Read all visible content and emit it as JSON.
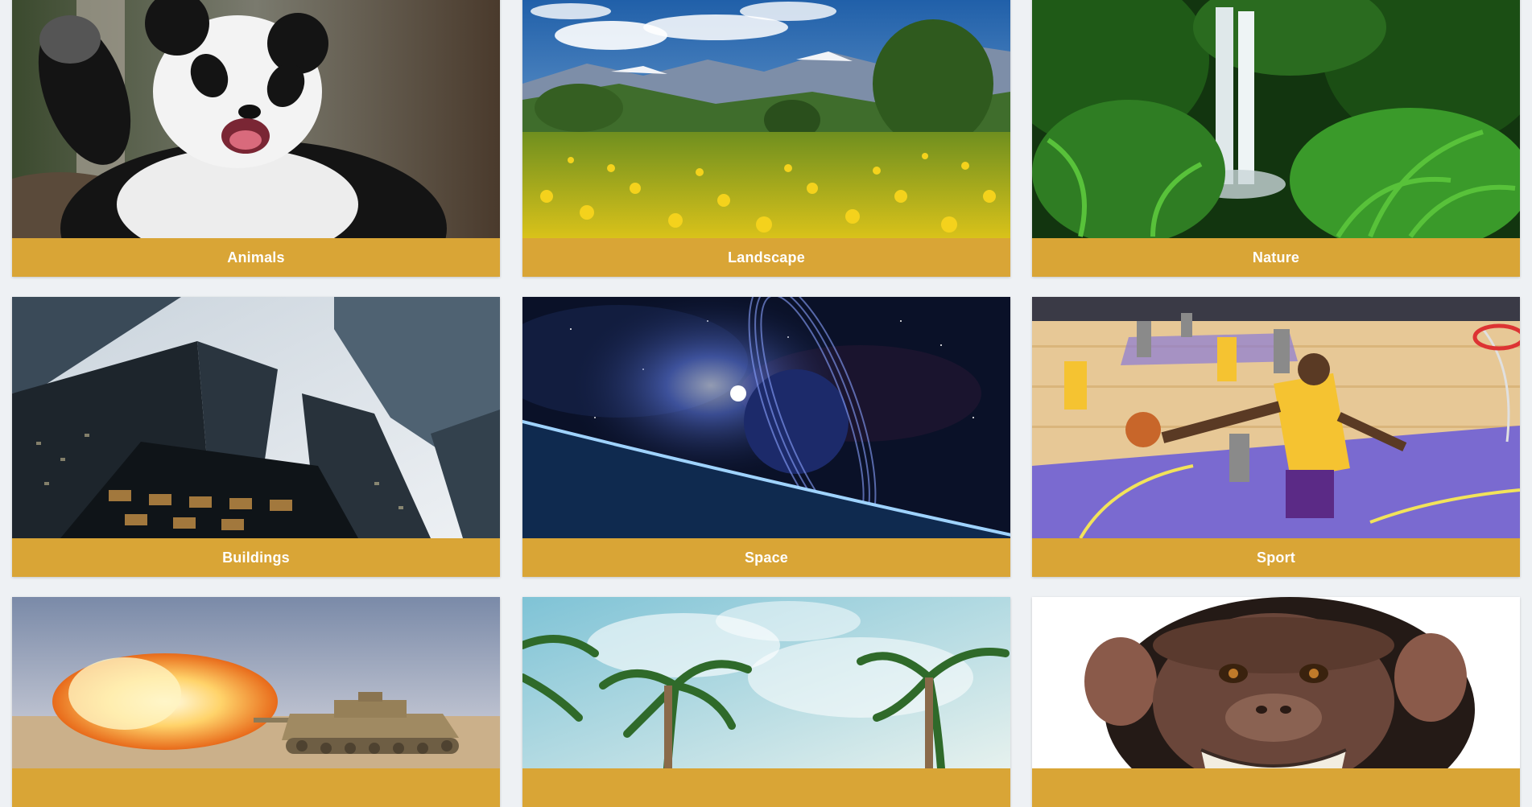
{
  "gallery": {
    "categories": [
      {
        "label": "Animals",
        "image": "giant panda waving"
      },
      {
        "label": "Landscape",
        "image": "mountain meadow with yellow dandelions"
      },
      {
        "label": "Nature",
        "image": "jungle waterfall with ferns"
      },
      {
        "label": "Buildings",
        "image": "glass skyscrapers from below"
      },
      {
        "label": "Space",
        "image": "ringed planet over earth horizon"
      },
      {
        "label": "Sport",
        "image": "basketball player dunking"
      },
      {
        "label": "",
        "image": "tank firing in desert"
      },
      {
        "label": "",
        "image": "palm trees against sky"
      },
      {
        "label": "",
        "image": "smiling chimpanzee"
      }
    ]
  },
  "colors": {
    "caption_background": "#d9a536",
    "caption_text": "#ffffff",
    "page_background": "#eef1f4"
  }
}
